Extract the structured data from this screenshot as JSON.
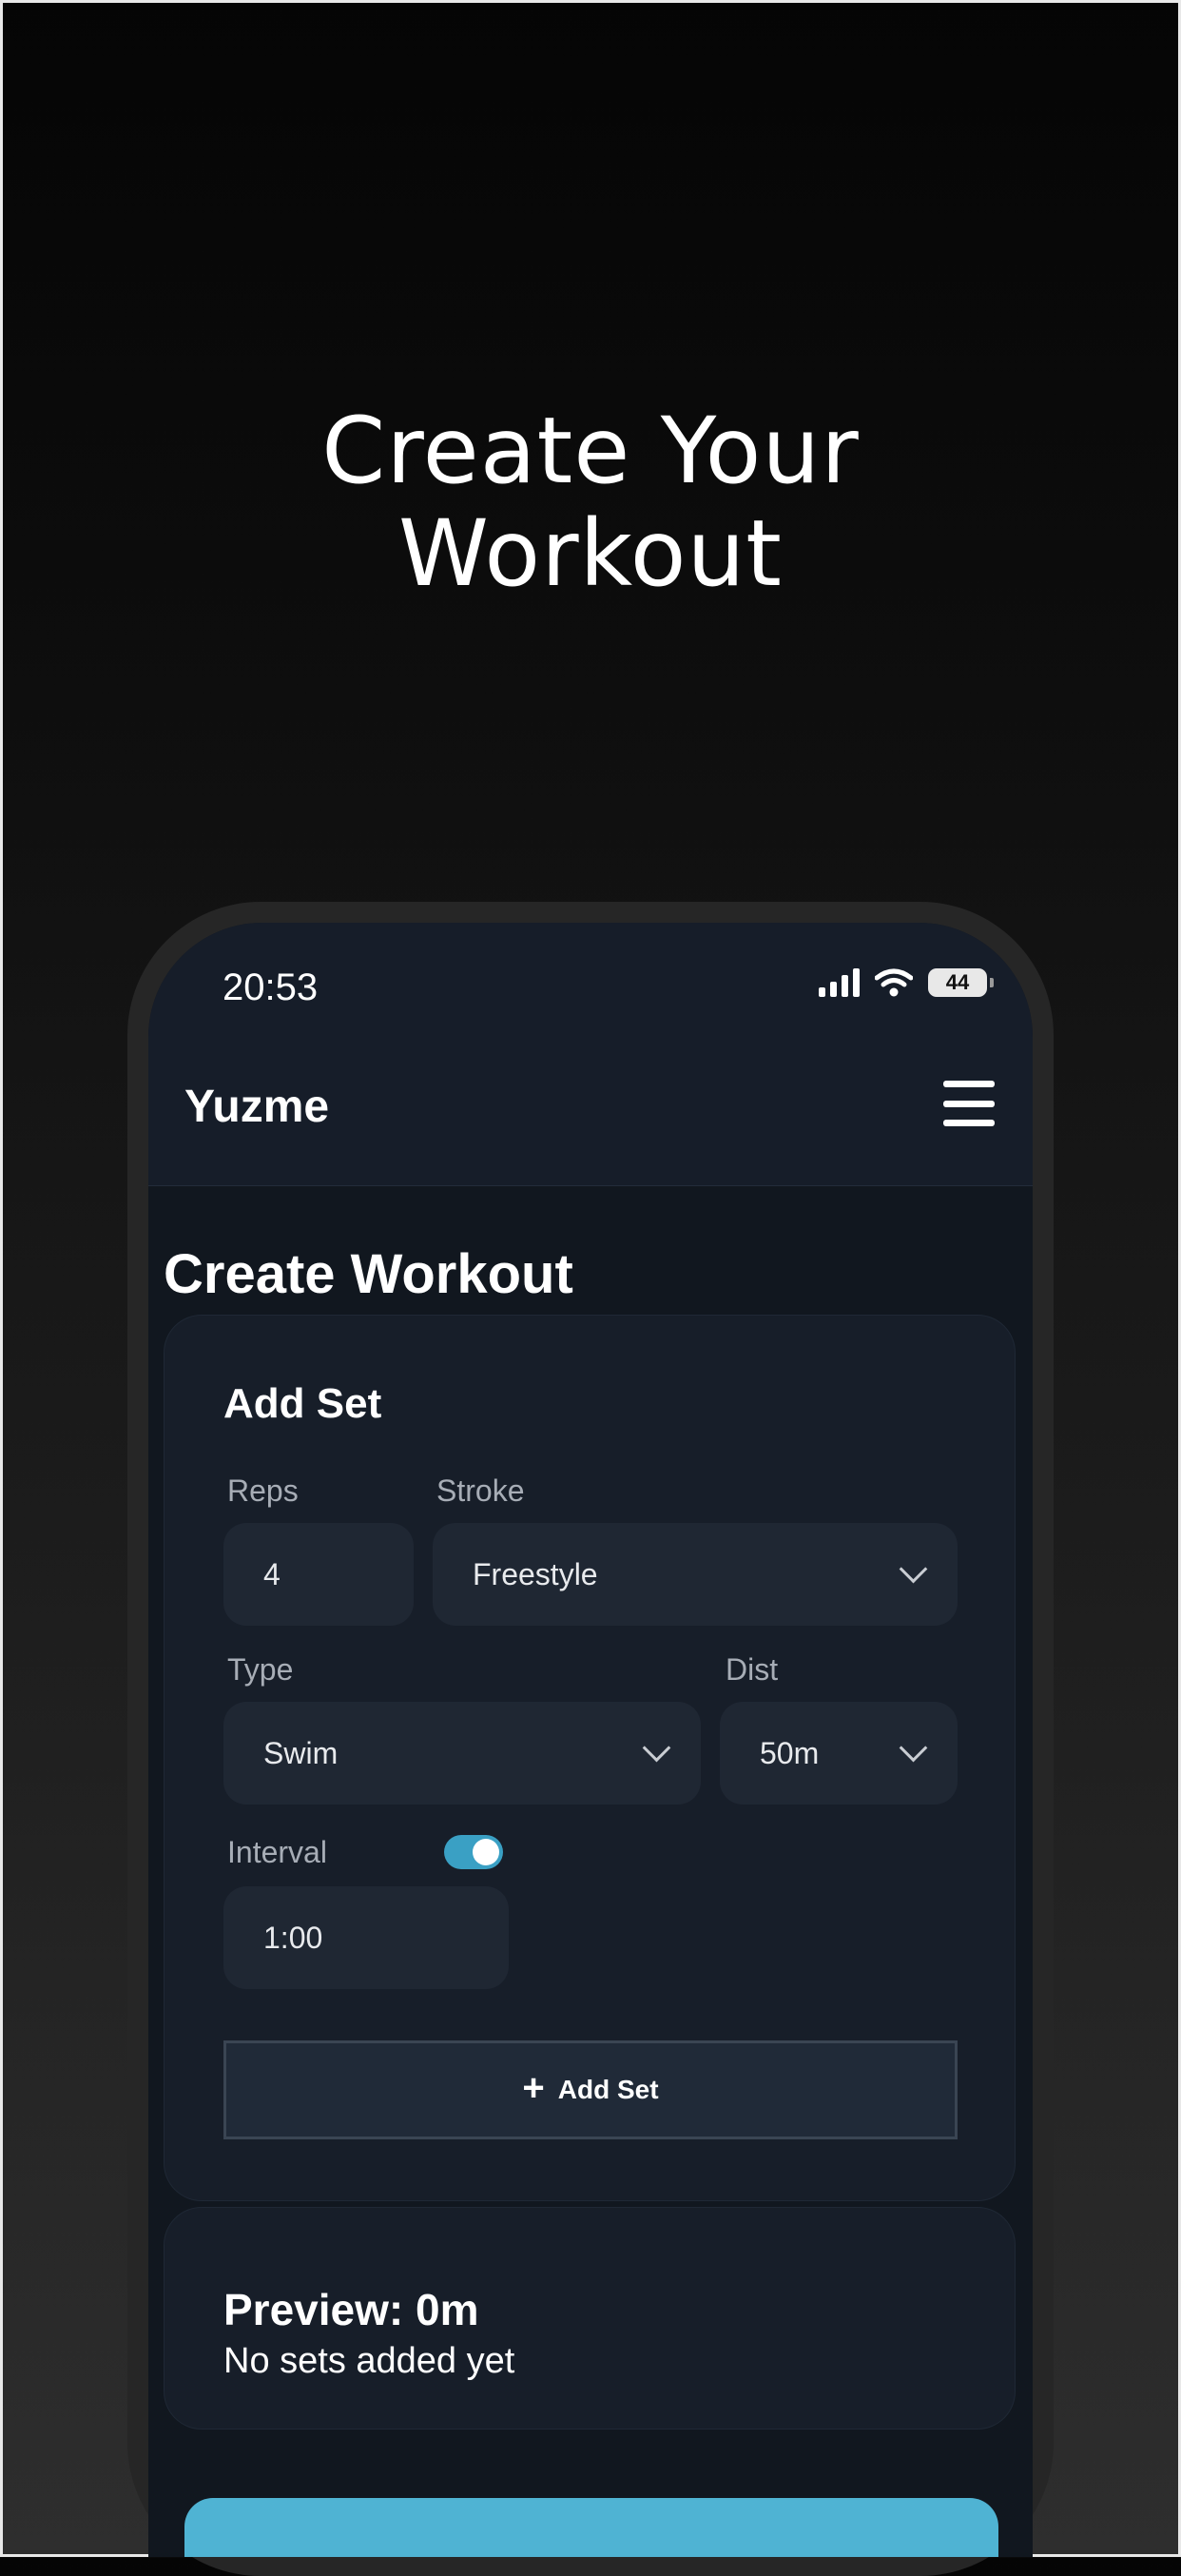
{
  "promo": {
    "title_line1": "Create Your",
    "title_line2": "Workout"
  },
  "status_bar": {
    "time": "20:53",
    "battery": "44"
  },
  "header": {
    "app_name": "Yuzme",
    "menu_icon": "hamburger-menu-icon"
  },
  "page": {
    "title": "Create Workout"
  },
  "add_set": {
    "title": "Add Set",
    "reps": {
      "label": "Reps",
      "value": "4"
    },
    "stroke": {
      "label": "Stroke",
      "value": "Freestyle"
    },
    "type": {
      "label": "Type",
      "value": "Swim"
    },
    "dist": {
      "label": "Dist",
      "value": "50m"
    },
    "interval": {
      "label": "Interval",
      "enabled": true,
      "value": "1:00"
    },
    "button_label": "Add Set"
  },
  "preview": {
    "title": "Preview: 0m",
    "empty_text": "No sets added yet"
  },
  "colors": {
    "accent": "#3aa0c4",
    "background": "#11171f",
    "card": "#171e29"
  }
}
